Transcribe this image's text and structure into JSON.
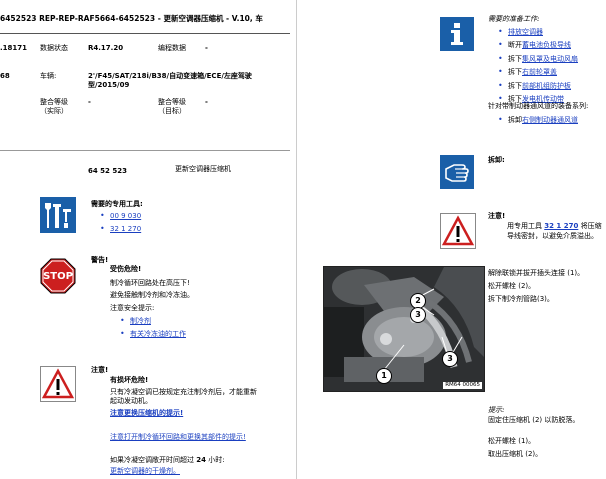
{
  "header": {
    "title": "6452523  REP-REP-RAF5664-6452523 - 更新空调器压缩机 - V.10,  车"
  },
  "meta": {
    "row1_left": ".18171",
    "data_status_label": "数据状态",
    "data_status_value": "R4.17.20",
    "edit_data_label": "编程数据",
    "edit_data_value": "-",
    "row2_left": "68",
    "vehicle_label": "车辆:",
    "vehicle_value": "2'/F45/SAT/218i/B38/自动变速箱/ECE/左座驾驶型/2015/09",
    "integration_actual_label": "整合等级\n（实际）",
    "integration_actual_value": "-",
    "integration_target_label": "整合等级\n（目标）",
    "integration_target_value": "-"
  },
  "section": {
    "code": "64 52 523",
    "title": "更新空调器压缩机"
  },
  "special_tools": {
    "heading": "需要的专用工具:",
    "items": [
      "00 9 030",
      "32 1 270"
    ]
  },
  "warning": {
    "heading": "警告!",
    "danger": "受伤危险!",
    "line1": "制冷循环回路处在高压下!",
    "line2": "避免接触制冷剂和冷冻油。",
    "line3": "注意安全提示:",
    "links": [
      "制冷剂",
      "有关冷冻油的工作"
    ],
    "stop_text": "STOP"
  },
  "caution": {
    "heading": "注意!",
    "danger": "有损坏危险!",
    "line1": "只有冷凝空调已按规定充注制冷剂后，才能重新起动发动机。",
    "link1": "注意更换压缩机的提示!",
    "link2": "注意打开制冷循环回路和更换其部件的提示!",
    "line2_prefix": "如果冷凝空调敞开时间超过",
    "line2_hours": "24",
    "line2_suffix": "小时:",
    "link3": "更新空调器的干燥剂。"
  },
  "prep": {
    "heading": "需要的准备工作:",
    "items": [
      {
        "text": "排放空调器",
        "link": true
      },
      {
        "text_prefix": "断开",
        "text": "蓄电池负极导线",
        "link": true
      },
      {
        "text_prefix": "拆下",
        "text": "集风罩及电动风扇",
        "link": true
      },
      {
        "text_prefix": "拆下",
        "text": "右前轮罩盖",
        "link": true
      },
      {
        "text_prefix": "拆下",
        "text": "前部机组防护板",
        "link": true
      },
      {
        "text_prefix": "拆下",
        "text": "发电机传动带",
        "link": true
      }
    ],
    "vehicle_note": "针对带制动器通风道的装备系列:",
    "vehicle_item_prefix": "拆卸",
    "vehicle_item_link": "右侧制动器通风道"
  },
  "removal": {
    "heading": "拆卸:"
  },
  "note_tool": {
    "heading": "注意!",
    "line1_prefix": "用专用工具",
    "line1_link": "32 1 270",
    "line1_suffix": "将压缩",
    "line2": "导线密封，以避免介质溢出。"
  },
  "figure": {
    "caption": "RM64 00065",
    "callouts": [
      "1",
      "2",
      "3",
      "2",
      "3"
    ]
  },
  "steps": {
    "line1": "解除联锁并拔开插头连接 (1)。",
    "line2": "松开螺栓 (2)。",
    "line3": "拆下制冷剂管路(3)。"
  },
  "hint": {
    "heading": "提示:",
    "line1": "固定住压缩机 (2) 以防脱落。",
    "line2": "松开螺栓 (1)。",
    "line3": "取出压缩机 (2)。"
  },
  "colors": {
    "blue_icon": "#1a5fa8",
    "stop_red": "#cc1f1f",
    "link": "#1a3fc0"
  }
}
